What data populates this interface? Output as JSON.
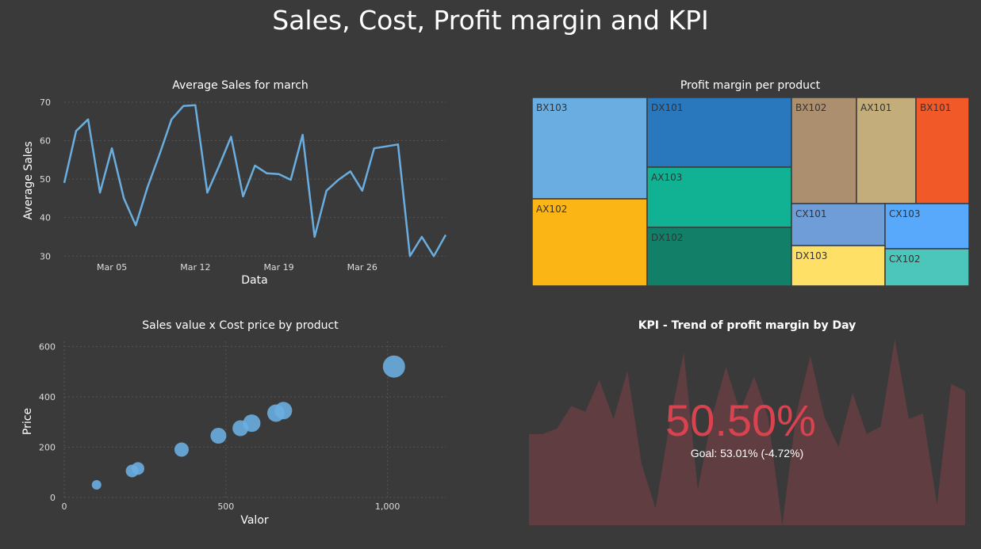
{
  "page": {
    "title": "Sales, Cost, Profit margin and KPI"
  },
  "chart_data": [
    {
      "type": "line",
      "title": "Average Sales for march",
      "xlabel": "Data",
      "ylabel": "Average Sales",
      "ylim": [
        28,
        71
      ],
      "y_ticks": [
        30,
        40,
        50,
        60,
        70
      ],
      "x_tick_labels": [
        "Mar 05",
        "Mar 12",
        "Mar 19",
        "Mar 26"
      ],
      "x_tick_days": [
        5,
        12,
        19,
        26
      ],
      "color": "#6aaee0",
      "points": [
        {
          "day": 1,
          "value": 49
        },
        {
          "day": 2,
          "value": 62.5
        },
        {
          "day": 3,
          "value": 65.5
        },
        {
          "day": 4,
          "value": 46.5
        },
        {
          "day": 5,
          "value": 58
        },
        {
          "day": 6,
          "value": 45
        },
        {
          "day": 7,
          "value": 38
        },
        {
          "day": 8,
          "value": 48
        },
        {
          "day": 9,
          "value": 56.5
        },
        {
          "day": 10,
          "value": 65.5
        },
        {
          "day": 11,
          "value": 69
        },
        {
          "day": 12,
          "value": 69.2
        },
        {
          "day": 13,
          "value": 46.5
        },
        {
          "day": 14,
          "value": 53.5
        },
        {
          "day": 15,
          "value": 61
        },
        {
          "day": 16,
          "value": 45.5
        },
        {
          "day": 17,
          "value": 53.5
        },
        {
          "day": 18,
          "value": 51.5
        },
        {
          "day": 19,
          "value": 51.3
        },
        {
          "day": 20,
          "value": 49.8
        },
        {
          "day": 21,
          "value": 61.5
        },
        {
          "day": 22,
          "value": 35
        },
        {
          "day": 23,
          "value": 47
        },
        {
          "day": 24,
          "value": 49.8
        },
        {
          "day": 25,
          "value": 52
        },
        {
          "day": 26,
          "value": 47
        },
        {
          "day": 27,
          "value": 58
        },
        {
          "day": 28,
          "value": 58.5
        },
        {
          "day": 29,
          "value": 59
        },
        {
          "day": 30,
          "value": 30
        },
        {
          "day": 31,
          "value": 35
        },
        {
          "day": 32,
          "value": 30
        },
        {
          "day": 33,
          "value": 35.5
        }
      ]
    },
    {
      "type": "treemap",
      "title": "Profit margin per product",
      "tiles": [
        {
          "label": "BX103",
          "color": "#6aade0"
        },
        {
          "label": "AX102",
          "color": "#fbb515"
        },
        {
          "label": "DX101",
          "color": "#2977bd"
        },
        {
          "label": "AX103",
          "color": "#10b293"
        },
        {
          "label": "DX102",
          "color": "#128068"
        },
        {
          "label": "BX102",
          "color": "#ac8f6e"
        },
        {
          "label": "AX101",
          "color": "#c3ad7a"
        },
        {
          "label": "BX101",
          "color": "#f15a28"
        },
        {
          "label": "CX101",
          "color": "#6f9dd8"
        },
        {
          "label": "CX103",
          "color": "#58a8fb"
        },
        {
          "label": "DX103",
          "color": "#fee067"
        },
        {
          "label": "CX102",
          "color": "#4cc6bb"
        }
      ]
    },
    {
      "type": "scatter",
      "title": "Sales value x Cost price by product",
      "xlabel": "Valor",
      "ylabel": "Price",
      "xlim": [
        0,
        1180
      ],
      "ylim": [
        -10,
        620
      ],
      "x_ticks": [
        {
          "value": 0,
          "label": "0"
        },
        {
          "value": 500,
          "label": "500"
        },
        {
          "value": 1000,
          "label": "1,000"
        }
      ],
      "y_ticks": [
        {
          "value": 0,
          "label": "0"
        },
        {
          "value": 200,
          "label": "200"
        },
        {
          "value": 400,
          "label": "400"
        },
        {
          "value": 600,
          "label": "600"
        }
      ],
      "color": "#6aaee0",
      "points": [
        {
          "x": 100,
          "y": 50,
          "r": 6
        },
        {
          "x": 210,
          "y": 105,
          "r": 8
        },
        {
          "x": 228,
          "y": 115,
          "r": 8
        },
        {
          "x": 363,
          "y": 190,
          "r": 9
        },
        {
          "x": 477,
          "y": 245,
          "r": 10
        },
        {
          "x": 545,
          "y": 275,
          "r": 10
        },
        {
          "x": 580,
          "y": 295,
          "r": 11
        },
        {
          "x": 655,
          "y": 335,
          "r": 11
        },
        {
          "x": 678,
          "y": 345,
          "r": 11
        },
        {
          "x": 1020,
          "y": 520,
          "r": 14
        }
      ]
    },
    {
      "type": "area",
      "title": "KPI - Trend of profit margin by Day",
      "kpi_value": "50.50%",
      "goal_text": "Goal: 53.01% (-4.72%)",
      "fill_color": "#7a3f45",
      "value_color": "#d9434f",
      "ylim": [
        0,
        100
      ],
      "values": [
        49,
        49,
        52,
        64,
        61,
        78,
        57,
        83,
        33,
        9,
        55,
        93,
        19,
        58,
        85,
        61,
        80,
        58,
        0,
        60,
        91,
        58,
        42,
        71,
        49,
        53,
        100,
        57,
        60,
        11,
        76,
        72
      ]
    }
  ]
}
